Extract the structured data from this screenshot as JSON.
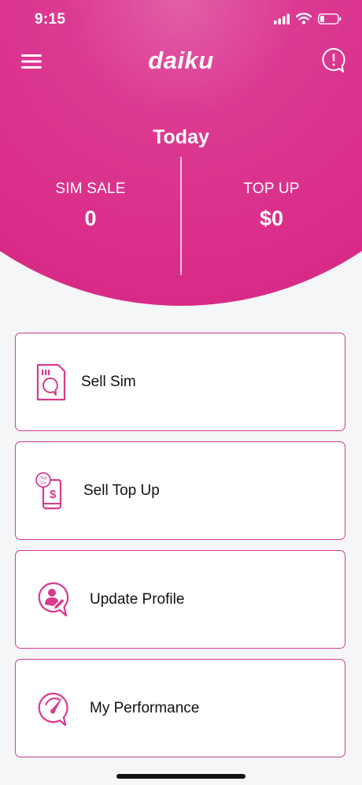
{
  "status_bar": {
    "time": "9:15",
    "icons": [
      "signal-icon",
      "wifi-icon",
      "battery-icon"
    ]
  },
  "nav": {
    "brand": "daiku",
    "menu_icon": "hamburger-menu-icon",
    "alert_icon": "alert-bubble-icon"
  },
  "summary": {
    "title": "Today",
    "sim_sale_label": "SIM SALE",
    "sim_sale_value": "0",
    "top_up_label": "TOP UP",
    "top_up_value": "$0"
  },
  "actions": [
    {
      "label": "Sell Sim",
      "icon": "sim-card-icon"
    },
    {
      "label": "Sell Top Up",
      "icon": "phone-topup-icon"
    },
    {
      "label": "Update Profile",
      "icon": "profile-edit-icon"
    },
    {
      "label": "My Performance",
      "icon": "speedometer-icon"
    }
  ],
  "colors": {
    "brand": "#d92c89",
    "accent_border": "#d63b8e",
    "background": "#f4f6f7"
  }
}
